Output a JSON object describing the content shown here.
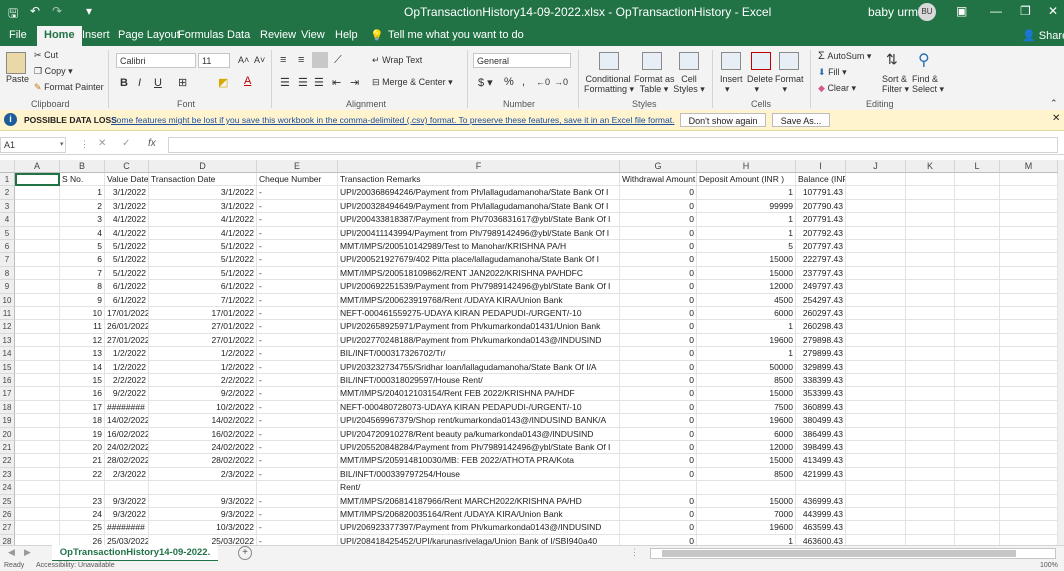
{
  "app": {
    "title": "OpTransactionHistory14-09-2022.xlsx - OpTransactionHistory - Excel",
    "user": "baby urmila",
    "user_initials": "BU",
    "accent": "#217346"
  },
  "tabs": [
    "File",
    "Home",
    "Insert",
    "Page Layout",
    "Formulas",
    "Data",
    "Review",
    "View",
    "Help"
  ],
  "tell_me": "Tell me what you want to do",
  "share": "Share",
  "ribbon": {
    "paste": "Paste",
    "cut": "Cut",
    "copy": "Copy",
    "format_painter": "Format Painter",
    "clipboard": "Clipboard",
    "font_name": "Calibri",
    "font_size": "11",
    "font": "Font",
    "wrap_text": "Wrap Text",
    "merge_center": "Merge & Center",
    "alignment": "Alignment",
    "number_format": "General",
    "number": "Number",
    "conditional": "Conditional",
    "formatting": "Formatting",
    "format_as": "Format as",
    "table": "Table",
    "cell": "Cell",
    "styles_lbl": "Styles",
    "styles": "Styles",
    "insert": "Insert",
    "delete": "Delete",
    "format": "Format",
    "cells": "Cells",
    "autosum": "AutoSum",
    "fill": "Fill",
    "clear": "Clear",
    "sort": "Sort &",
    "filter": "Filter",
    "find": "Find &",
    "select": "Select",
    "editing": "Editing"
  },
  "infobar": {
    "title": "POSSIBLE DATA LOSS",
    "message": "Some features might be lost if you save this workbook in the comma-delimited (.csv) format. To preserve these features, save it in an Excel file format.",
    "dont_show": "Don't show again",
    "save_as": "Save As..."
  },
  "formula_bar": {
    "name_box": "A1",
    "fx": "fx",
    "value": ""
  },
  "columns": [
    "A",
    "B",
    "C",
    "D",
    "E",
    "F",
    "G",
    "H",
    "I",
    "J",
    "K",
    "L",
    "M"
  ],
  "rows": [
    [
      "",
      "S No.",
      "Value Date",
      "Transaction Date",
      "Cheque Number",
      "Transaction Remarks",
      "Withdrawal Amount",
      "Deposit Amount (INR )",
      "Balance (INR )"
    ],
    [
      "",
      "1",
      "3/1/2022",
      "3/1/2022",
      "-",
      "UPI/200368694246/Payment from Ph/lallagudamanoha/State Bank Of I",
      "0",
      "1",
      "107791.43"
    ],
    [
      "",
      "2",
      "3/1/2022",
      "3/1/2022",
      "-",
      "UPI/200328494649/Payment from Ph/lallagudamanoha/State Bank Of I",
      "0",
      "99999",
      "207790.43"
    ],
    [
      "",
      "3",
      "4/1/2022",
      "4/1/2022",
      "-",
      "UPI/200433818387/Payment from Ph/7036831617@ybl/State Bank Of I",
      "0",
      "1",
      "207791.43"
    ],
    [
      "",
      "4",
      "4/1/2022",
      "4/1/2022",
      "-",
      "UPI/200411143994/Payment from Ph/7989142496@ybl/State Bank Of I",
      "0",
      "1",
      "207792.43"
    ],
    [
      "",
      "5",
      "5/1/2022",
      "5/1/2022",
      "-",
      "MMT/IMPS/200510142989/Test to Manohar/KRISHNA PA/H",
      "0",
      "5",
      "207797.43"
    ],
    [
      "",
      "6",
      "5/1/2022",
      "5/1/2022",
      "-",
      "UPI/200521927679/402 Pitta place/lallagudamanoha/State Bank Of I",
      "0",
      "15000",
      "222797.43"
    ],
    [
      "",
      "7",
      "5/1/2022",
      "5/1/2022",
      "-",
      "MMT/IMPS/200518109862/RENT JAN2022/KRISHNA PA/HDFC",
      "0",
      "15000",
      "237797.43"
    ],
    [
      "",
      "8",
      "6/1/2022",
      "6/1/2022",
      "-",
      "UPI/200692251539/Payment from Ph/7989142496@ybl/State Bank Of I",
      "0",
      "12000",
      "249797.43"
    ],
    [
      "",
      "9",
      "6/1/2022",
      "7/1/2022",
      "-",
      "MMT/IMPS/200623919768/Rent /UDAYA KIRA/Union Bank",
      "0",
      "4500",
      "254297.43"
    ],
    [
      "",
      "10",
      "17/01/2022",
      "17/01/2022",
      "-",
      "NEFT-000461559275-UDAYA KIRAN PEDAPUDI-/URGENT/-10",
      "0",
      "6000",
      "260297.43"
    ],
    [
      "",
      "11",
      "26/01/2022",
      "27/01/2022",
      "-",
      "UPI/202658925971/Payment from Ph/kumarkonda01431/Union Bank",
      "0",
      "1",
      "260298.43"
    ],
    [
      "",
      "12",
      "27/01/2022",
      "27/01/2022",
      "-",
      "UPI/202770248188/Payment from Ph/kumarkonda0143@/INDUSIND",
      "0",
      "19600",
      "279898.43"
    ],
    [
      "",
      "13",
      "1/2/2022",
      "1/2/2022",
      "-",
      "BIL/INFT/000317326702/Tr/",
      "0",
      "1",
      "279899.43"
    ],
    [
      "",
      "14",
      "1/2/2022",
      "1/2/2022",
      "-",
      "UPI/203232734755/Sridhar loan/lallagudamanoha/State Bank Of I/A",
      "0",
      "50000",
      "329899.43"
    ],
    [
      "",
      "15",
      "2/2/2022",
      "2/2/2022",
      "-",
      "BIL/INFT/000318029597/House Rent/",
      "0",
      "8500",
      "338399.43"
    ],
    [
      "",
      "16",
      "9/2/2022",
      "9/2/2022",
      "-",
      "MMT/IMPS/204012103154/Rent FEB 2022/KRISHNA PA/HDF",
      "0",
      "15000",
      "353399.43"
    ],
    [
      "",
      "17",
      "########",
      "10/2/2022",
      "-",
      "NEFT-000480728073-UDAYA KIRAN PEDAPUDI-/URGENT/-10",
      "0",
      "7500",
      "360899.43"
    ],
    [
      "",
      "18",
      "14/02/2022",
      "14/02/2022",
      "-",
      "UPI/204569967379/Shop rent/kumarkonda0143@/INDUSIND BANK/A",
      "0",
      "19600",
      "380499.43"
    ],
    [
      "",
      "19",
      "16/02/2022",
      "16/02/2022",
      "-",
      "UPI/204720910278/Rent  beauty pa/kumarkonda0143@/INDUSIND",
      "0",
      "6000",
      "386499.43"
    ],
    [
      "",
      "20",
      "24/02/2022",
      "24/02/2022",
      "-",
      "UPI/205520848284/Payment from Ph/7989142496@ybl/State Bank Of I",
      "0",
      "12000",
      "398499.43"
    ],
    [
      "",
      "21",
      "28/02/2022",
      "28/02/2022",
      "-",
      "MMT/IMPS/205914810030/MB: FEB 2022/ATHOTA PRA/Kota",
      "0",
      "15000",
      "413499.43"
    ],
    [
      "",
      "22",
      "2/3/2022",
      "2/3/2022",
      "-",
      "BIL/INFT/000339797254/House",
      "0",
      "8500",
      "421999.43"
    ],
    [
      "",
      "",
      "",
      "",
      "",
      "Rent/",
      "",
      "",
      ""
    ],
    [
      "",
      "23",
      "9/3/2022",
      "9/3/2022",
      "-",
      "MMT/IMPS/206814187966/Rent MARCH2022/KRISHNA PA/HD",
      "0",
      "15000",
      "436999.43"
    ],
    [
      "",
      "24",
      "9/3/2022",
      "9/3/2022",
      "-",
      "MMT/IMPS/206820035164/Rent /UDAYA KIRA/Union Bank",
      "0",
      "7000",
      "443999.43"
    ],
    [
      "",
      "25",
      "########",
      "10/3/2022",
      "-",
      "UPI/206923377397/Payment from Ph/kumarkonda0143@/INDUSIND",
      "0",
      "19600",
      "463599.43"
    ],
    [
      "",
      "26",
      "25/03/2022",
      "25/03/2022",
      "-",
      "UPI/208418425452/UPI/karunasrivelaga/Union Bank of I/SBI940a40",
      "0",
      "1",
      "463600.43"
    ]
  ],
  "sheet_tab": "OpTransactionHistory14-09-2022.",
  "status": {
    "ready": "Ready",
    "accessibility": "Accessibility: Unavailable",
    "zoom": "100%"
  }
}
